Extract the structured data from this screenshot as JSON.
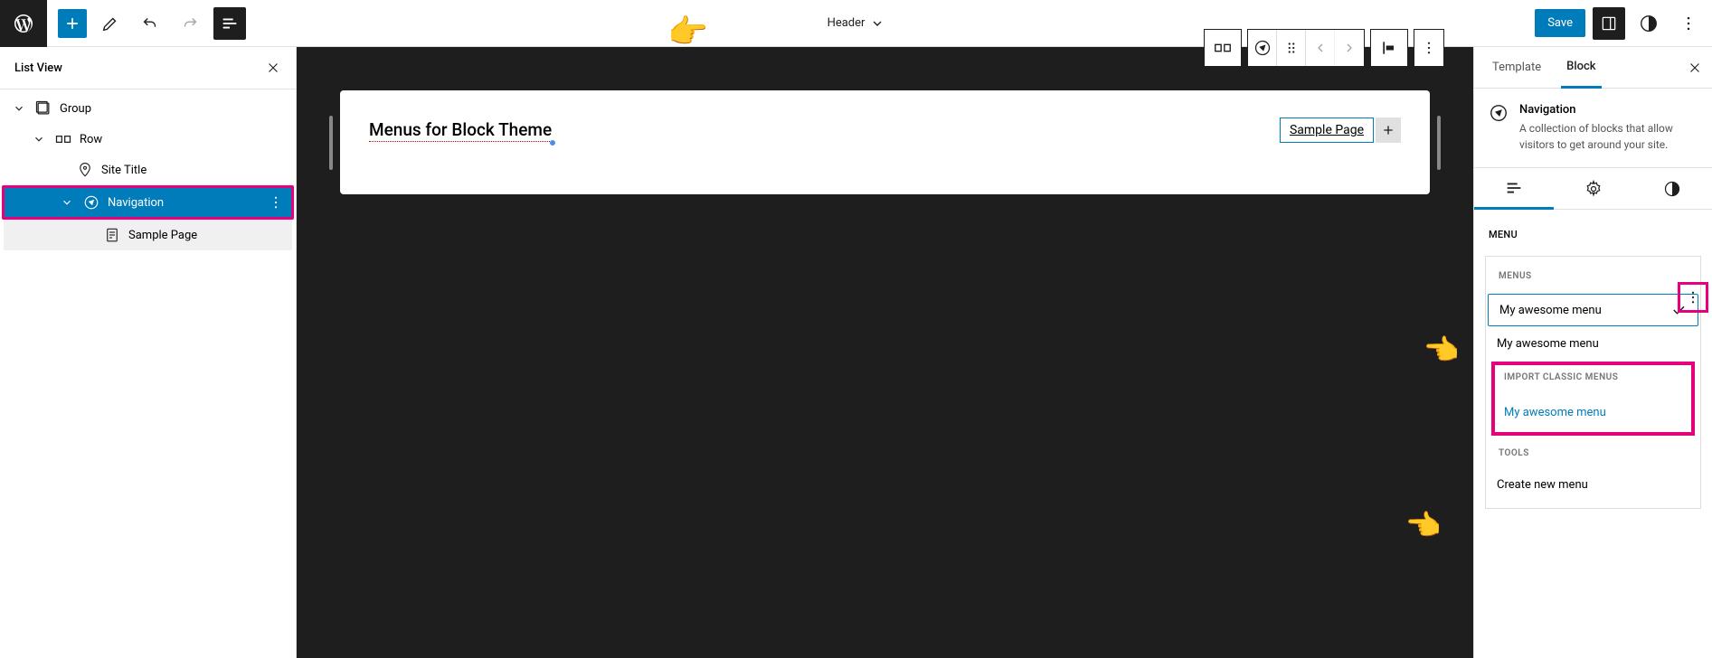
{
  "topbar": {
    "title": "Header",
    "save_label": "Save"
  },
  "list_view": {
    "title": "List View",
    "items": [
      {
        "label": "Group",
        "icon": "group"
      },
      {
        "label": "Row",
        "icon": "row"
      },
      {
        "label": "Site Title",
        "icon": "site-title"
      },
      {
        "label": "Navigation",
        "icon": "navigation"
      },
      {
        "label": "Sample Page",
        "icon": "page"
      }
    ]
  },
  "canvas": {
    "page_title": "Menus for Block Theme",
    "nav_link": "Sample Page"
  },
  "sidebar": {
    "tabs": {
      "template": "Template",
      "block": "Block"
    },
    "block_name": "Navigation",
    "block_desc": "A collection of blocks that allow visitors to get around your site.",
    "menu_label": "Menu",
    "dropdown": {
      "menus_heading": "MENUS",
      "menu1": "My awesome menu",
      "menu2": "My awesome menu",
      "import_heading": "IMPORT CLASSIC MENUS",
      "import_item": "My awesome menu",
      "tools_heading": "TOOLS",
      "create_new": "Create new menu"
    }
  }
}
